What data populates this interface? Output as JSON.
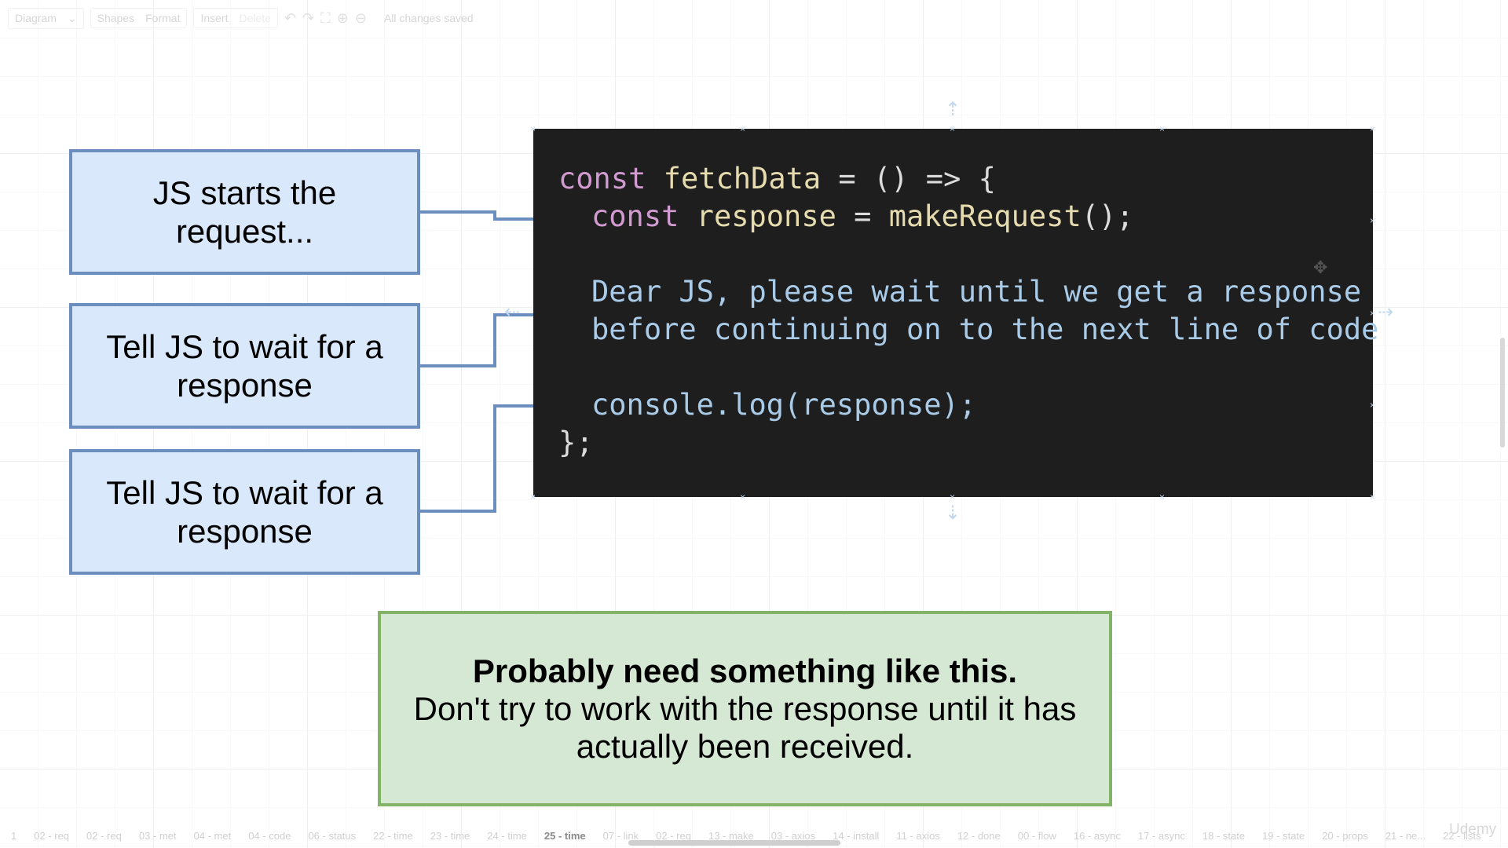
{
  "toolbar": {
    "diagram_label": "Diagram",
    "shapes_label": "Shapes",
    "format_label": "Format",
    "insert_label": "Insert",
    "delete_label": "Delete",
    "status_text": "All changes saved"
  },
  "steps": [
    {
      "label": "JS starts the request..."
    },
    {
      "label": "Tell JS to wait for a response"
    },
    {
      "label": "Tell JS to wait for a response"
    }
  ],
  "code": {
    "line1_kw": "const",
    "line1_fn": " fetchData",
    "line1_rest": " = () => {",
    "line2_kw": "const",
    "line2_fn": " response",
    "line2_eq": " = ",
    "line2_call": "makeRequest",
    "line2_rest": "();",
    "comment_line1": "Dear JS, please wait until we get a response",
    "comment_line2": "before continuing on to the next line of code",
    "line5": "console.log(response);",
    "line6": "};"
  },
  "note": {
    "title": "Probably need something like this.",
    "body": "Don't try to work with the response until it has actually been received."
  },
  "bottom_tabs": [
    "1",
    "02 - req",
    "02 - req",
    "03 - met",
    "04 - met",
    "04 - code",
    "06 - status",
    "22 - time",
    "23 - time",
    "24 - time",
    "25 - time",
    "07 - link",
    "02 - req",
    "13 - make",
    "03 - axios",
    "14 - install",
    "11 - axios",
    "12 - done",
    "00 - flow",
    "16 - async",
    "17 - async",
    "18 - state",
    "19 - state",
    "20 - props",
    "21 - ne...",
    "22 - lists"
  ],
  "active_tab": "25 - time",
  "watermark": "Udemy",
  "colors": {
    "blue_fill": "#dae8fc",
    "blue_stroke": "#6c8ebf",
    "green_fill": "#d5e8d4",
    "green_stroke": "#82b366",
    "code_bg": "#1e1e1e"
  }
}
